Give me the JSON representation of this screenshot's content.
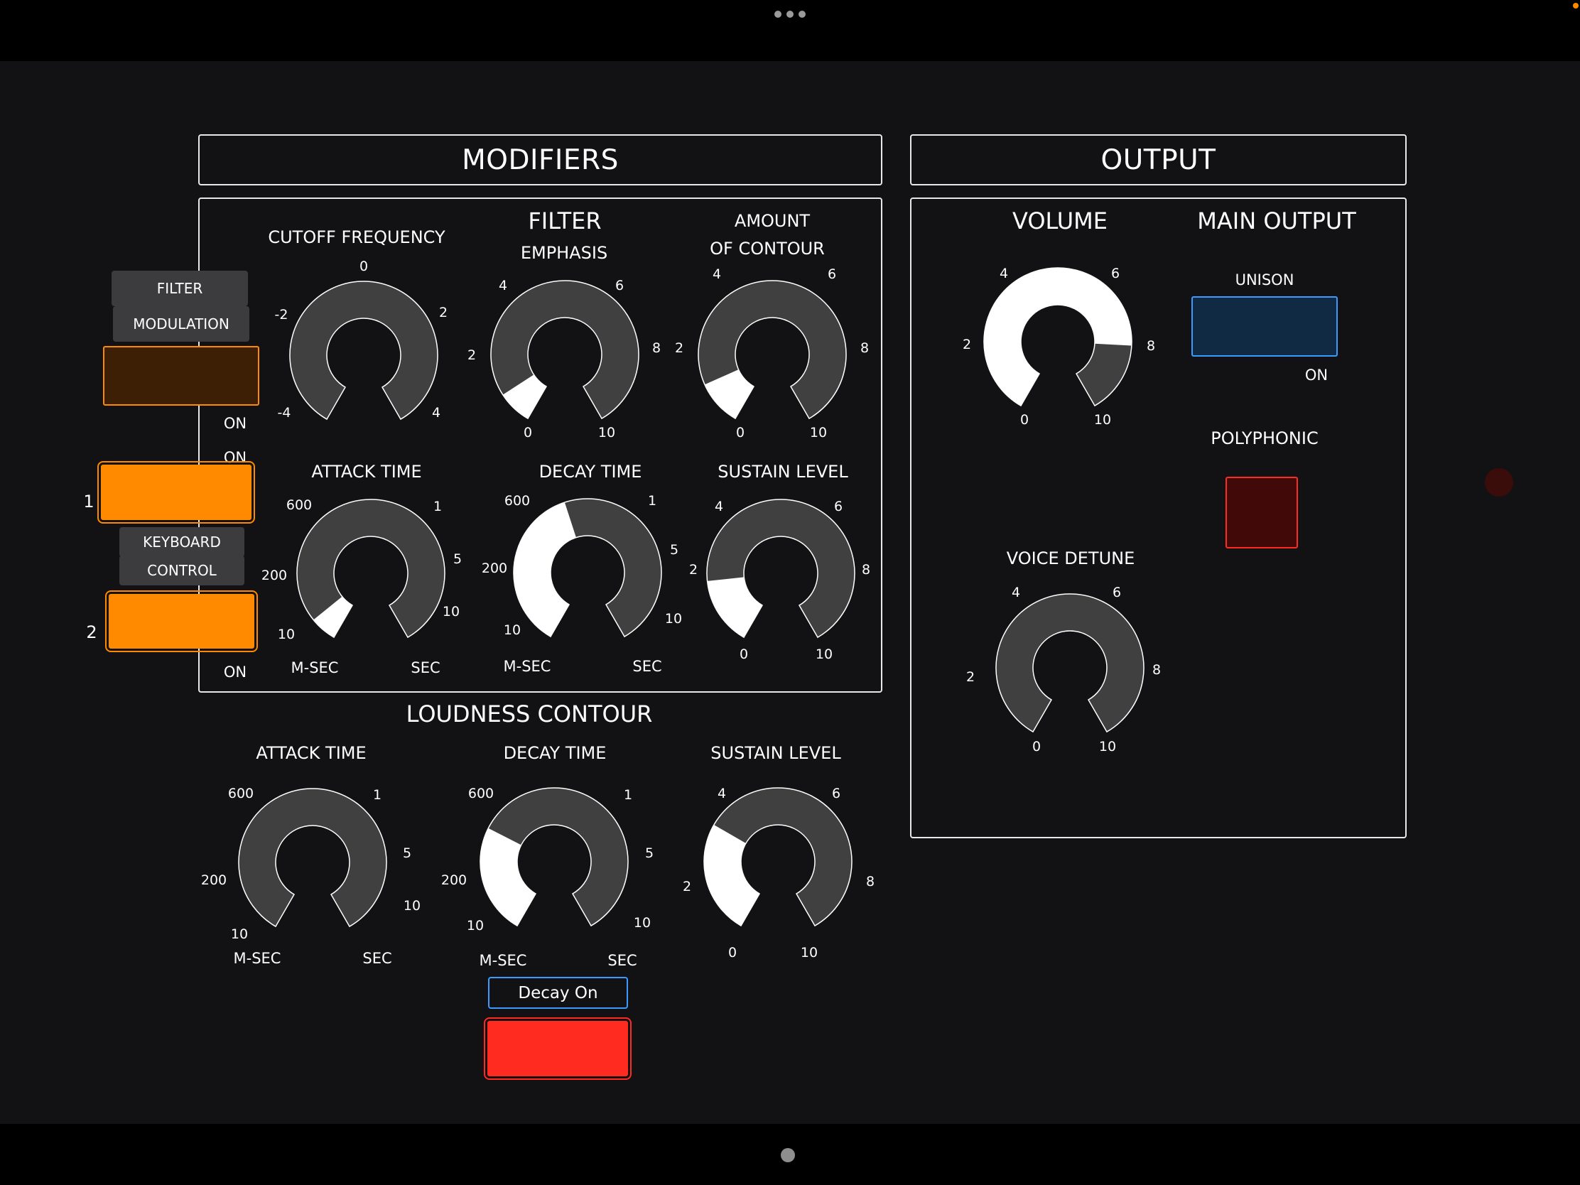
{
  "colors": {
    "background": "#121214",
    "panel_border": "#e8e8e8",
    "knob_track": "#404040",
    "knob_fill": "#ffffff",
    "orange": "#ff8a00",
    "red": "#ff2a20",
    "blue": "#3d9bff"
  },
  "sections": {
    "modifiers": "MODIFIERS",
    "output": "OUTPUT"
  },
  "filter": {
    "title": "FILTER",
    "cutoff": {
      "label": "CUTOFF FREQUENCY",
      "value": -4,
      "min": -4,
      "max": 4,
      "ticks": {
        "left": "-2",
        "top": "0",
        "right": "2",
        "bottom_left": "-4",
        "bottom_right": "4"
      }
    },
    "emphasis": {
      "label": "EMPHASIS",
      "value": 0.9,
      "min": 0,
      "max": 10,
      "ticks": {
        "top_left": "4",
        "top_right": "6",
        "left": "2",
        "right": "8",
        "bottom_left": "0",
        "bottom_right": "10"
      }
    },
    "contour_amount": {
      "label_line1": "AMOUNT",
      "label_line2": "OF CONTOUR",
      "value": 1.2,
      "min": 0,
      "max": 10,
      "ticks": {
        "top_left": "4",
        "top_right": "6",
        "left": "2",
        "right": "8",
        "bottom_left": "0",
        "bottom_right": "10"
      }
    },
    "attack": {
      "label": "ATTACK TIME",
      "value": 0.7,
      "ticks": {
        "top_left": "600",
        "top_right": "1",
        "left": "200",
        "right": "5",
        "bottom_left": "10",
        "bottom_right": "10"
      },
      "unit_left": "M-SEC",
      "unit_right": "SEC"
    },
    "decay": {
      "label": "DECAY TIME",
      "value": 4.4,
      "ticks": {
        "top_left": "600",
        "top_right": "1",
        "left": "200",
        "right": "5",
        "bottom_left": "10",
        "bottom_right": "10"
      },
      "unit_left": "M-SEC",
      "unit_right": "SEC"
    },
    "sustain": {
      "label": "SUSTAIN LEVEL",
      "value": 1.8,
      "min": 0,
      "max": 10,
      "ticks": {
        "top_left": "4",
        "top_right": "6",
        "left": "2",
        "right": "8",
        "bottom_left": "0",
        "bottom_right": "10"
      }
    }
  },
  "left_controls": {
    "filter_mod_line1": "FILTER",
    "filter_mod_line2": "MODULATION",
    "filter_mod_on": "ON",
    "keyboard_on_top": "ON",
    "keyboard_label_1": "1",
    "keyboard_line1": "KEYBOARD",
    "keyboard_line2": "CONTROL",
    "keyboard_label_2": "2",
    "keyboard_on_bottom": "ON"
  },
  "loudness": {
    "title": "LOUDNESS CONTOUR",
    "attack": {
      "label": "ATTACK TIME",
      "value": 0,
      "ticks": {
        "top_left": "600",
        "top_right": "1",
        "left": "200",
        "right": "5",
        "bottom_left": "10",
        "bottom_right": "10"
      },
      "unit_left": "M-SEC",
      "unit_right": "SEC"
    },
    "decay": {
      "label": "DECAY TIME",
      "value": 2.9,
      "ticks": {
        "top_left": "600",
        "top_right": "1",
        "left": "200",
        "right": "5",
        "bottom_left": "10",
        "bottom_right": "10"
      },
      "unit_left": "M-SEC",
      "unit_right": "SEC"
    },
    "sustain": {
      "label": "SUSTAIN LEVEL",
      "value": 3.0,
      "min": 0,
      "max": 10,
      "ticks": {
        "top_left": "4",
        "top_right": "6",
        "left": "2",
        "right": "8",
        "bottom_left": "0",
        "bottom_right": "10"
      }
    },
    "decay_button": "Decay On"
  },
  "output": {
    "volume": {
      "label": "VOLUME",
      "value": 8.1,
      "min": 0,
      "max": 10,
      "ticks": {
        "top_left": "4",
        "top_right": "6",
        "left": "2",
        "right": "8",
        "bottom_left": "0",
        "bottom_right": "10"
      }
    },
    "main_output": "MAIN OUTPUT",
    "unison": "UNISON",
    "unison_on": "ON",
    "polyphonic": "POLYPHONIC",
    "voice_detune": {
      "label": "VOICE DETUNE",
      "value": 0,
      "min": 0,
      "max": 10,
      "ticks": {
        "top_left": "4",
        "top_right": "6",
        "left": "2",
        "right": "8",
        "bottom_left": "0",
        "bottom_right": "10"
      }
    }
  }
}
